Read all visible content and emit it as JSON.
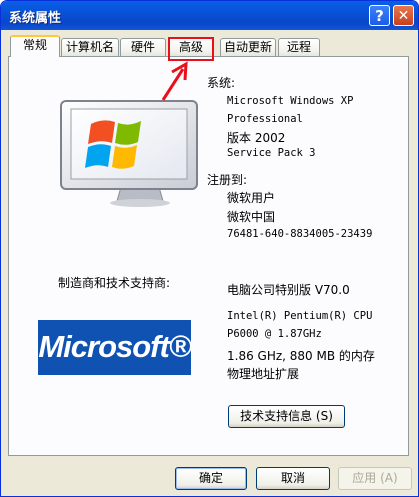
{
  "window": {
    "title": "系统属性",
    "help_glyph": "?",
    "close_glyph": "✕"
  },
  "tabs": [
    {
      "label": "常规"
    },
    {
      "label": "计算机名"
    },
    {
      "label": "硬件"
    },
    {
      "label": "高级"
    },
    {
      "label": "自动更新"
    },
    {
      "label": "远程"
    }
  ],
  "system": {
    "heading": "系统:",
    "lines": [
      "Microsoft Windows XP",
      "Professional",
      "版本 2002",
      "Service Pack 3"
    ]
  },
  "registered": {
    "heading": "注册到:",
    "lines": [
      "微软用户",
      "微软中国",
      "76481-640-8834005-23439"
    ]
  },
  "manufacturer": {
    "label": "制造商和技术支持商:",
    "name": "电脑公司特别版  V70.0",
    "logo_text": "Microsoft®",
    "specs": [
      "Intel(R) Pentium(R) CPU",
      " P6000  @ 1.87GHz",
      "1.86 GHz, 880 MB 的内存",
      "物理地址扩展"
    ],
    "support_button": "技术支持信息 (S)"
  },
  "footer": {
    "ok": "确定",
    "cancel": "取消",
    "apply": "应用 (A)"
  },
  "colors": {
    "title_bar": "#0a5fe8",
    "annotation": "#e8111b",
    "logo_bg": "#0f52b2"
  }
}
